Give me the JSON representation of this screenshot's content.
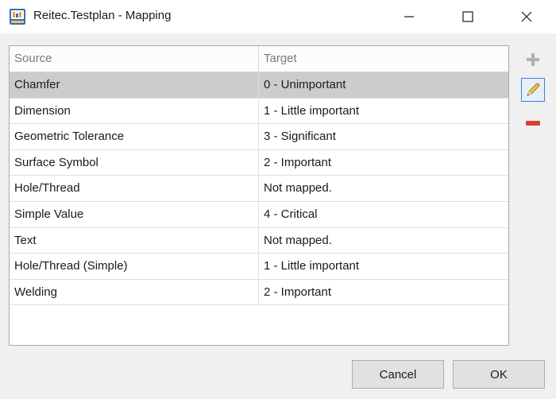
{
  "window": {
    "title": "Reitec.Testplan - Mapping",
    "icon": "testplan-app-icon",
    "controls": [
      "minimize-icon",
      "maximize-icon",
      "close-icon"
    ]
  },
  "grid": {
    "columns": [
      "Source",
      "Target"
    ],
    "rows": [
      {
        "source": "Chamfer",
        "target": "0 - Unimportant"
      },
      {
        "source": "Dimension",
        "target": "1 - Little important"
      },
      {
        "source": "Geometric Tolerance",
        "target": "3 - Significant"
      },
      {
        "source": "Surface Symbol",
        "target": "2 - Important"
      },
      {
        "source": "Hole/Thread",
        "target": "Not mapped."
      },
      {
        "source": "Simple Value",
        "target": "4 - Critical"
      },
      {
        "source": "Text",
        "target": "Not mapped."
      },
      {
        "source": "Hole/Thread (Simple)",
        "target": "1 - Little important"
      },
      {
        "source": "Welding",
        "target": "2 - Important"
      }
    ]
  },
  "side_buttons": [
    "add-icon",
    "edit-pencil-icon",
    "remove-icon"
  ],
  "buttons": {
    "cancel": "Cancel",
    "ok": "OK"
  },
  "colors": {
    "selected_row": "#cccccc",
    "remove_red": "#d9403a",
    "edit_focus": "#3c7fd6"
  }
}
